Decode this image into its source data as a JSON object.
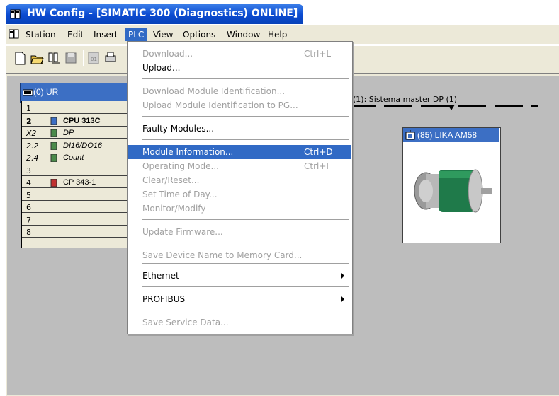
{
  "window": {
    "title": "HW Config - [SIMATIC 300 (Diagnostics)  ONLINE]"
  },
  "menubar": {
    "items": [
      {
        "label": "Station"
      },
      {
        "label": "Edit"
      },
      {
        "label": "Insert"
      },
      {
        "label": "PLC"
      },
      {
        "label": "View"
      },
      {
        "label": "Options"
      },
      {
        "label": "Window"
      },
      {
        "label": "Help"
      }
    ]
  },
  "toolbar": {
    "icons": [
      "new-icon",
      "open-icon",
      "station-icon",
      "save-icon",
      "compile-icon",
      "print-icon"
    ]
  },
  "rack": {
    "title": "(0) UR",
    "rows": [
      {
        "slot": "1",
        "module": ""
      },
      {
        "slot": "2",
        "module": "CPU 313C"
      },
      {
        "slot": "X2",
        "module": "DP"
      },
      {
        "slot": "2.2",
        "module": "DI16/DO16"
      },
      {
        "slot": "2.4",
        "module": "Count"
      },
      {
        "slot": "3",
        "module": ""
      },
      {
        "slot": "4",
        "module": "CP 343-1"
      },
      {
        "slot": "5",
        "module": ""
      },
      {
        "slot": "6",
        "module": ""
      },
      {
        "slot": "7",
        "module": ""
      },
      {
        "slot": "8",
        "module": ""
      }
    ]
  },
  "profibus": {
    "label": "(1): Sistema master DP (1)"
  },
  "device": {
    "title": "(85) LIKA AM58"
  },
  "plc_menu": {
    "items": [
      {
        "label": "Download...",
        "shortcut": "Ctrl+L",
        "enabled": false
      },
      {
        "label": "Upload...",
        "shortcut": "",
        "enabled": true
      },
      {
        "label": "Download Module Identification...",
        "shortcut": "",
        "enabled": false
      },
      {
        "label": "Upload Module Identification to PG...",
        "shortcut": "",
        "enabled": false
      },
      {
        "label": "Faulty Modules...",
        "shortcut": "",
        "enabled": true
      },
      {
        "label": "Module Information...",
        "shortcut": "Ctrl+D",
        "enabled": true,
        "highlighted": true
      },
      {
        "label": "Operating Mode...",
        "shortcut": "Ctrl+I",
        "enabled": false
      },
      {
        "label": "Clear/Reset...",
        "shortcut": "",
        "enabled": false
      },
      {
        "label": "Set Time of Day...",
        "shortcut": "",
        "enabled": false
      },
      {
        "label": "Monitor/Modify",
        "shortcut": "",
        "enabled": false
      },
      {
        "label": "Update Firmware...",
        "shortcut": "",
        "enabled": false
      },
      {
        "label": "Save Device Name to Memory Card...",
        "shortcut": "",
        "enabled": false
      },
      {
        "label": "Ethernet",
        "shortcut": "",
        "enabled": true,
        "submenu": true
      },
      {
        "label": "PROFIBUS",
        "shortcut": "",
        "enabled": true,
        "submenu": true
      },
      {
        "label": "Save Service Data...",
        "shortcut": "",
        "enabled": false
      }
    ]
  },
  "colors": {
    "title_bar": "#0a4ad0",
    "menu_highlight": "#316ac5",
    "rack_header": "#3c6fc4",
    "device_green": "#1f7a4a"
  }
}
